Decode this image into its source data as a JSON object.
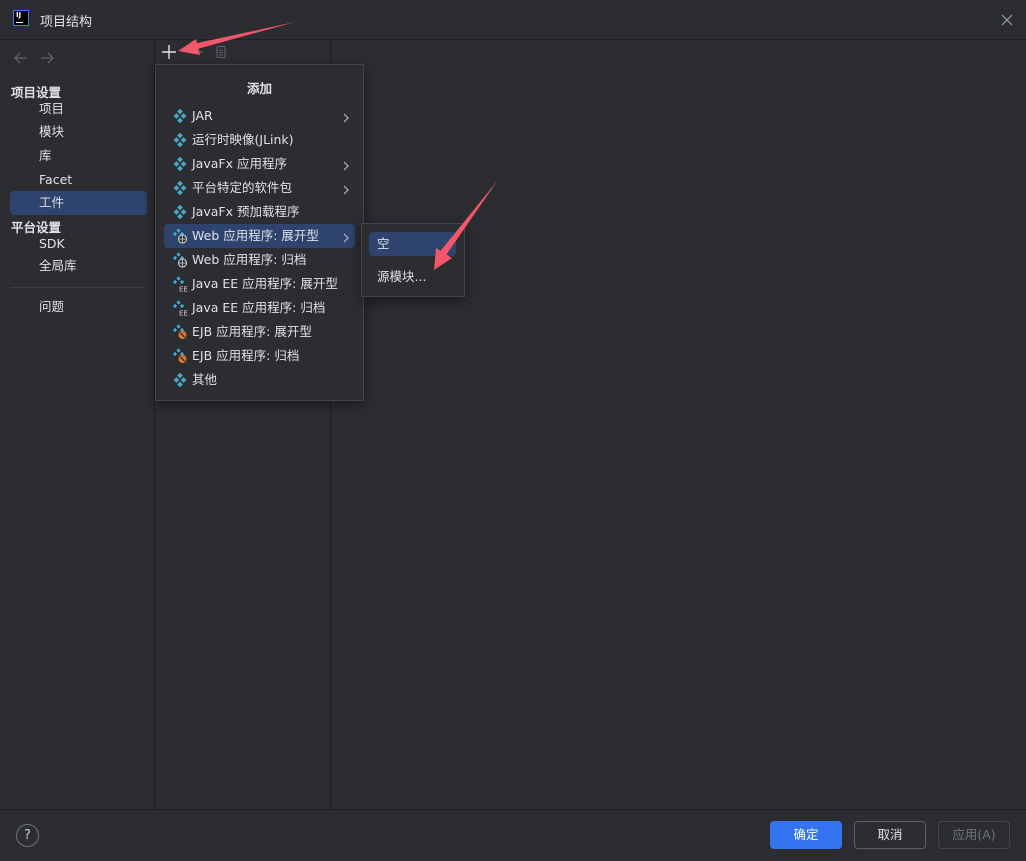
{
  "window": {
    "title": "项目结构"
  },
  "sidebar": {
    "section_project": "项目设置",
    "project_items": [
      {
        "label": "项目",
        "selected": false
      },
      {
        "label": "模块",
        "selected": false
      },
      {
        "label": "库",
        "selected": false
      },
      {
        "label": "Facet",
        "selected": false
      },
      {
        "label": "工件",
        "selected": true
      }
    ],
    "section_platform": "平台设置",
    "platform_items": [
      {
        "label": "SDK"
      },
      {
        "label": "全局库"
      }
    ],
    "problems": "问题"
  },
  "add_menu": {
    "title": "添加",
    "items": [
      {
        "label": "JAR",
        "icon": "diamond-artifact-icon",
        "has_submenu": true
      },
      {
        "label": "运行时映像(JLink)",
        "icon": "diamond-artifact-icon",
        "has_submenu": false
      },
      {
        "label": "JavaFx 应用程序",
        "icon": "diamond-artifact-icon",
        "has_submenu": true
      },
      {
        "label": "平台特定的软件包",
        "icon": "diamond-artifact-icon",
        "has_submenu": true
      },
      {
        "label": "JavaFx 预加载程序",
        "icon": "diamond-artifact-icon",
        "has_submenu": false
      },
      {
        "label": "Web 应用程序: 展开型",
        "icon": "web-artifact-icon",
        "has_submenu": true,
        "active": true
      },
      {
        "label": "Web 应用程序: 归档",
        "icon": "web-artifact-icon",
        "has_submenu": false
      },
      {
        "label": "Java EE 应用程序: 展开型",
        "icon": "javaee-artifact-icon",
        "has_submenu": false
      },
      {
        "label": "Java EE 应用程序: 归档",
        "icon": "javaee-artifact-icon",
        "has_submenu": false
      },
      {
        "label": "EJB 应用程序: 展开型",
        "icon": "ejb-artifact-icon",
        "has_submenu": false
      },
      {
        "label": "EJB 应用程序: 归档",
        "icon": "ejb-artifact-icon",
        "has_submenu": false
      },
      {
        "label": "其他",
        "icon": "diamond-artifact-icon",
        "has_submenu": false
      }
    ]
  },
  "submenu": {
    "items": [
      {
        "label": "空",
        "active": true
      },
      {
        "label": "源模块..."
      }
    ]
  },
  "footer": {
    "help": "?",
    "ok": "确定",
    "cancel": "取消",
    "apply": "应用(A)"
  },
  "colors": {
    "background": "#2b2d30",
    "selection": "#2e436e",
    "primary_button": "#3574f0",
    "artifact_icon": "#4aa8c9",
    "annotation_arrow": "#f2566b"
  }
}
